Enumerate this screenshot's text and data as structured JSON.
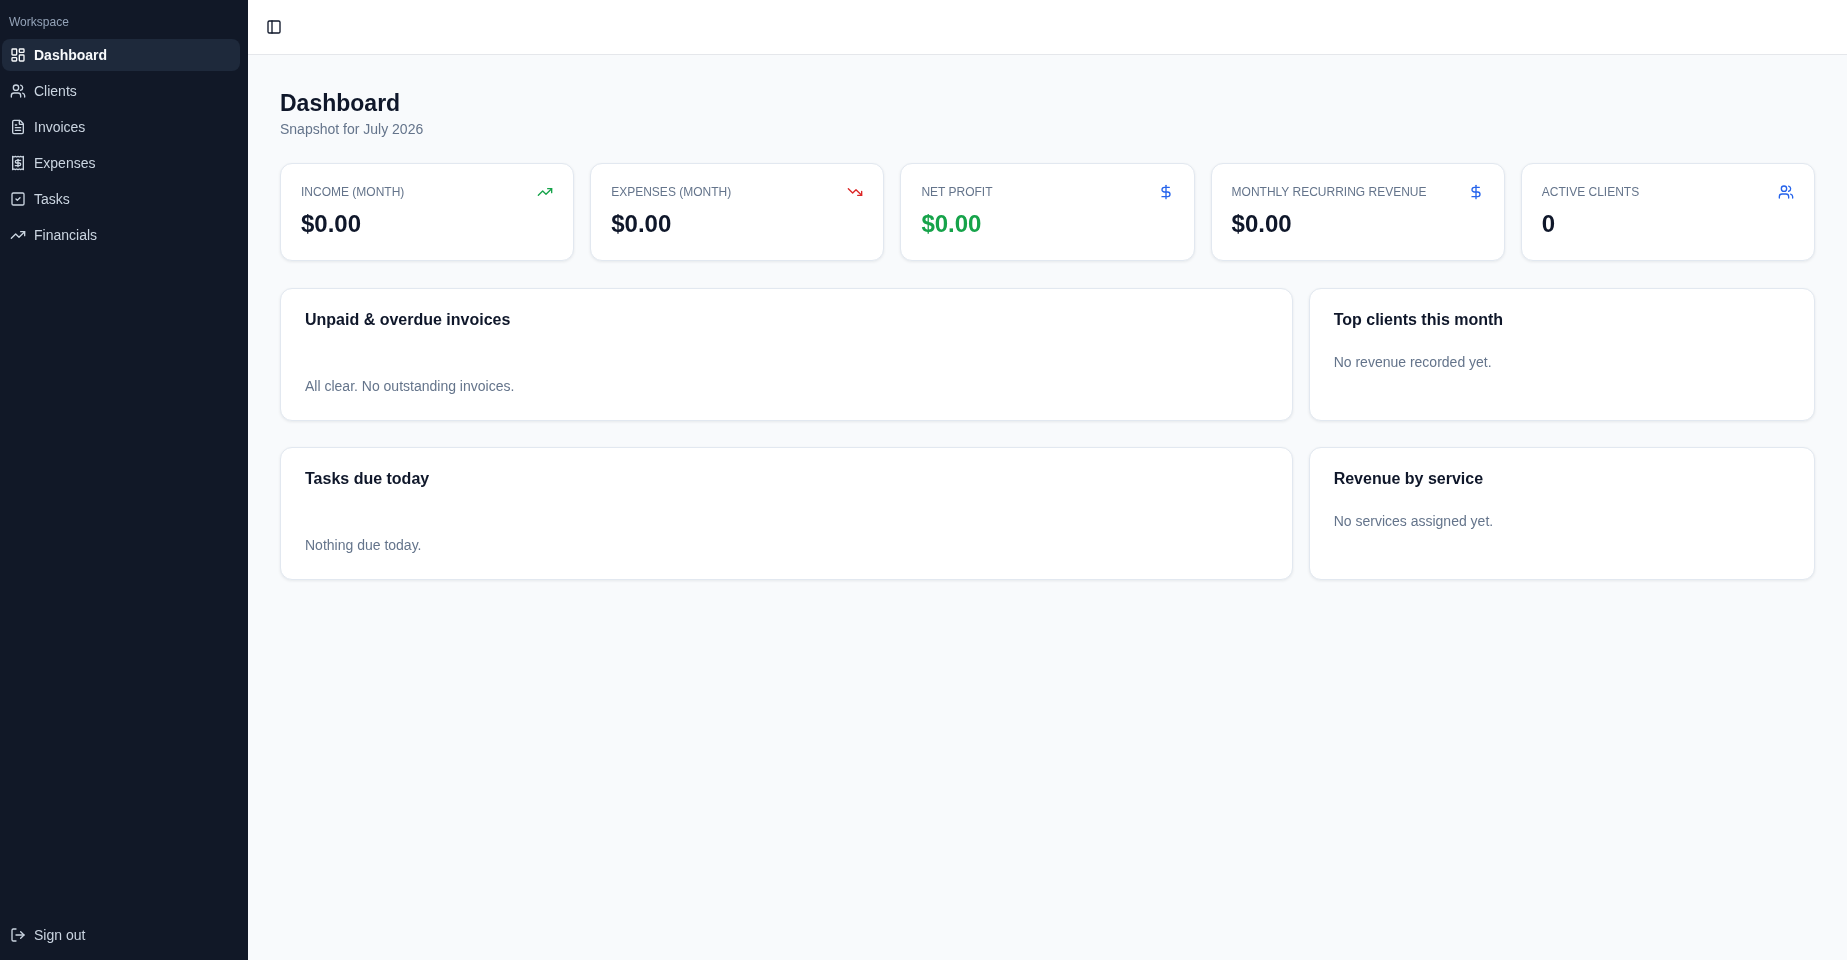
{
  "sidebar": {
    "section_label": "Workspace",
    "items": [
      {
        "label": "Dashboard",
        "selected": true
      },
      {
        "label": "Clients",
        "selected": false
      },
      {
        "label": "Invoices",
        "selected": false
      },
      {
        "label": "Expenses",
        "selected": false
      },
      {
        "label": "Tasks",
        "selected": false
      },
      {
        "label": "Financials",
        "selected": false
      }
    ],
    "sign_out": "Sign out"
  },
  "page": {
    "title": "Dashboard",
    "subtitle": "Snapshot for July 2026"
  },
  "stats": [
    {
      "label": "INCOME (MONTH)",
      "value": "$0.00",
      "color": "#16a34a",
      "positive": false
    },
    {
      "label": "EXPENSES (MONTH)",
      "value": "$0.00",
      "color": "#dc2626",
      "positive": false
    },
    {
      "label": "NET PROFIT",
      "value": "$0.00",
      "color": "#2563eb",
      "positive": true
    },
    {
      "label": "MONTHLY RECURRING REVENUE",
      "value": "$0.00",
      "color": "#2563eb",
      "positive": false
    },
    {
      "label": "ACTIVE CLIENTS",
      "value": "0",
      "color": "#2563eb",
      "positive": false
    }
  ],
  "panels": [
    {
      "title": "Unpaid & overdue invoices",
      "message": "All clear. No outstanding invoices."
    },
    {
      "title": "Top clients this month",
      "message": "No revenue recorded yet."
    },
    {
      "title": "Tasks due today",
      "message": "Nothing due today."
    },
    {
      "title": "Revenue by service",
      "message": "No services assigned yet."
    }
  ]
}
